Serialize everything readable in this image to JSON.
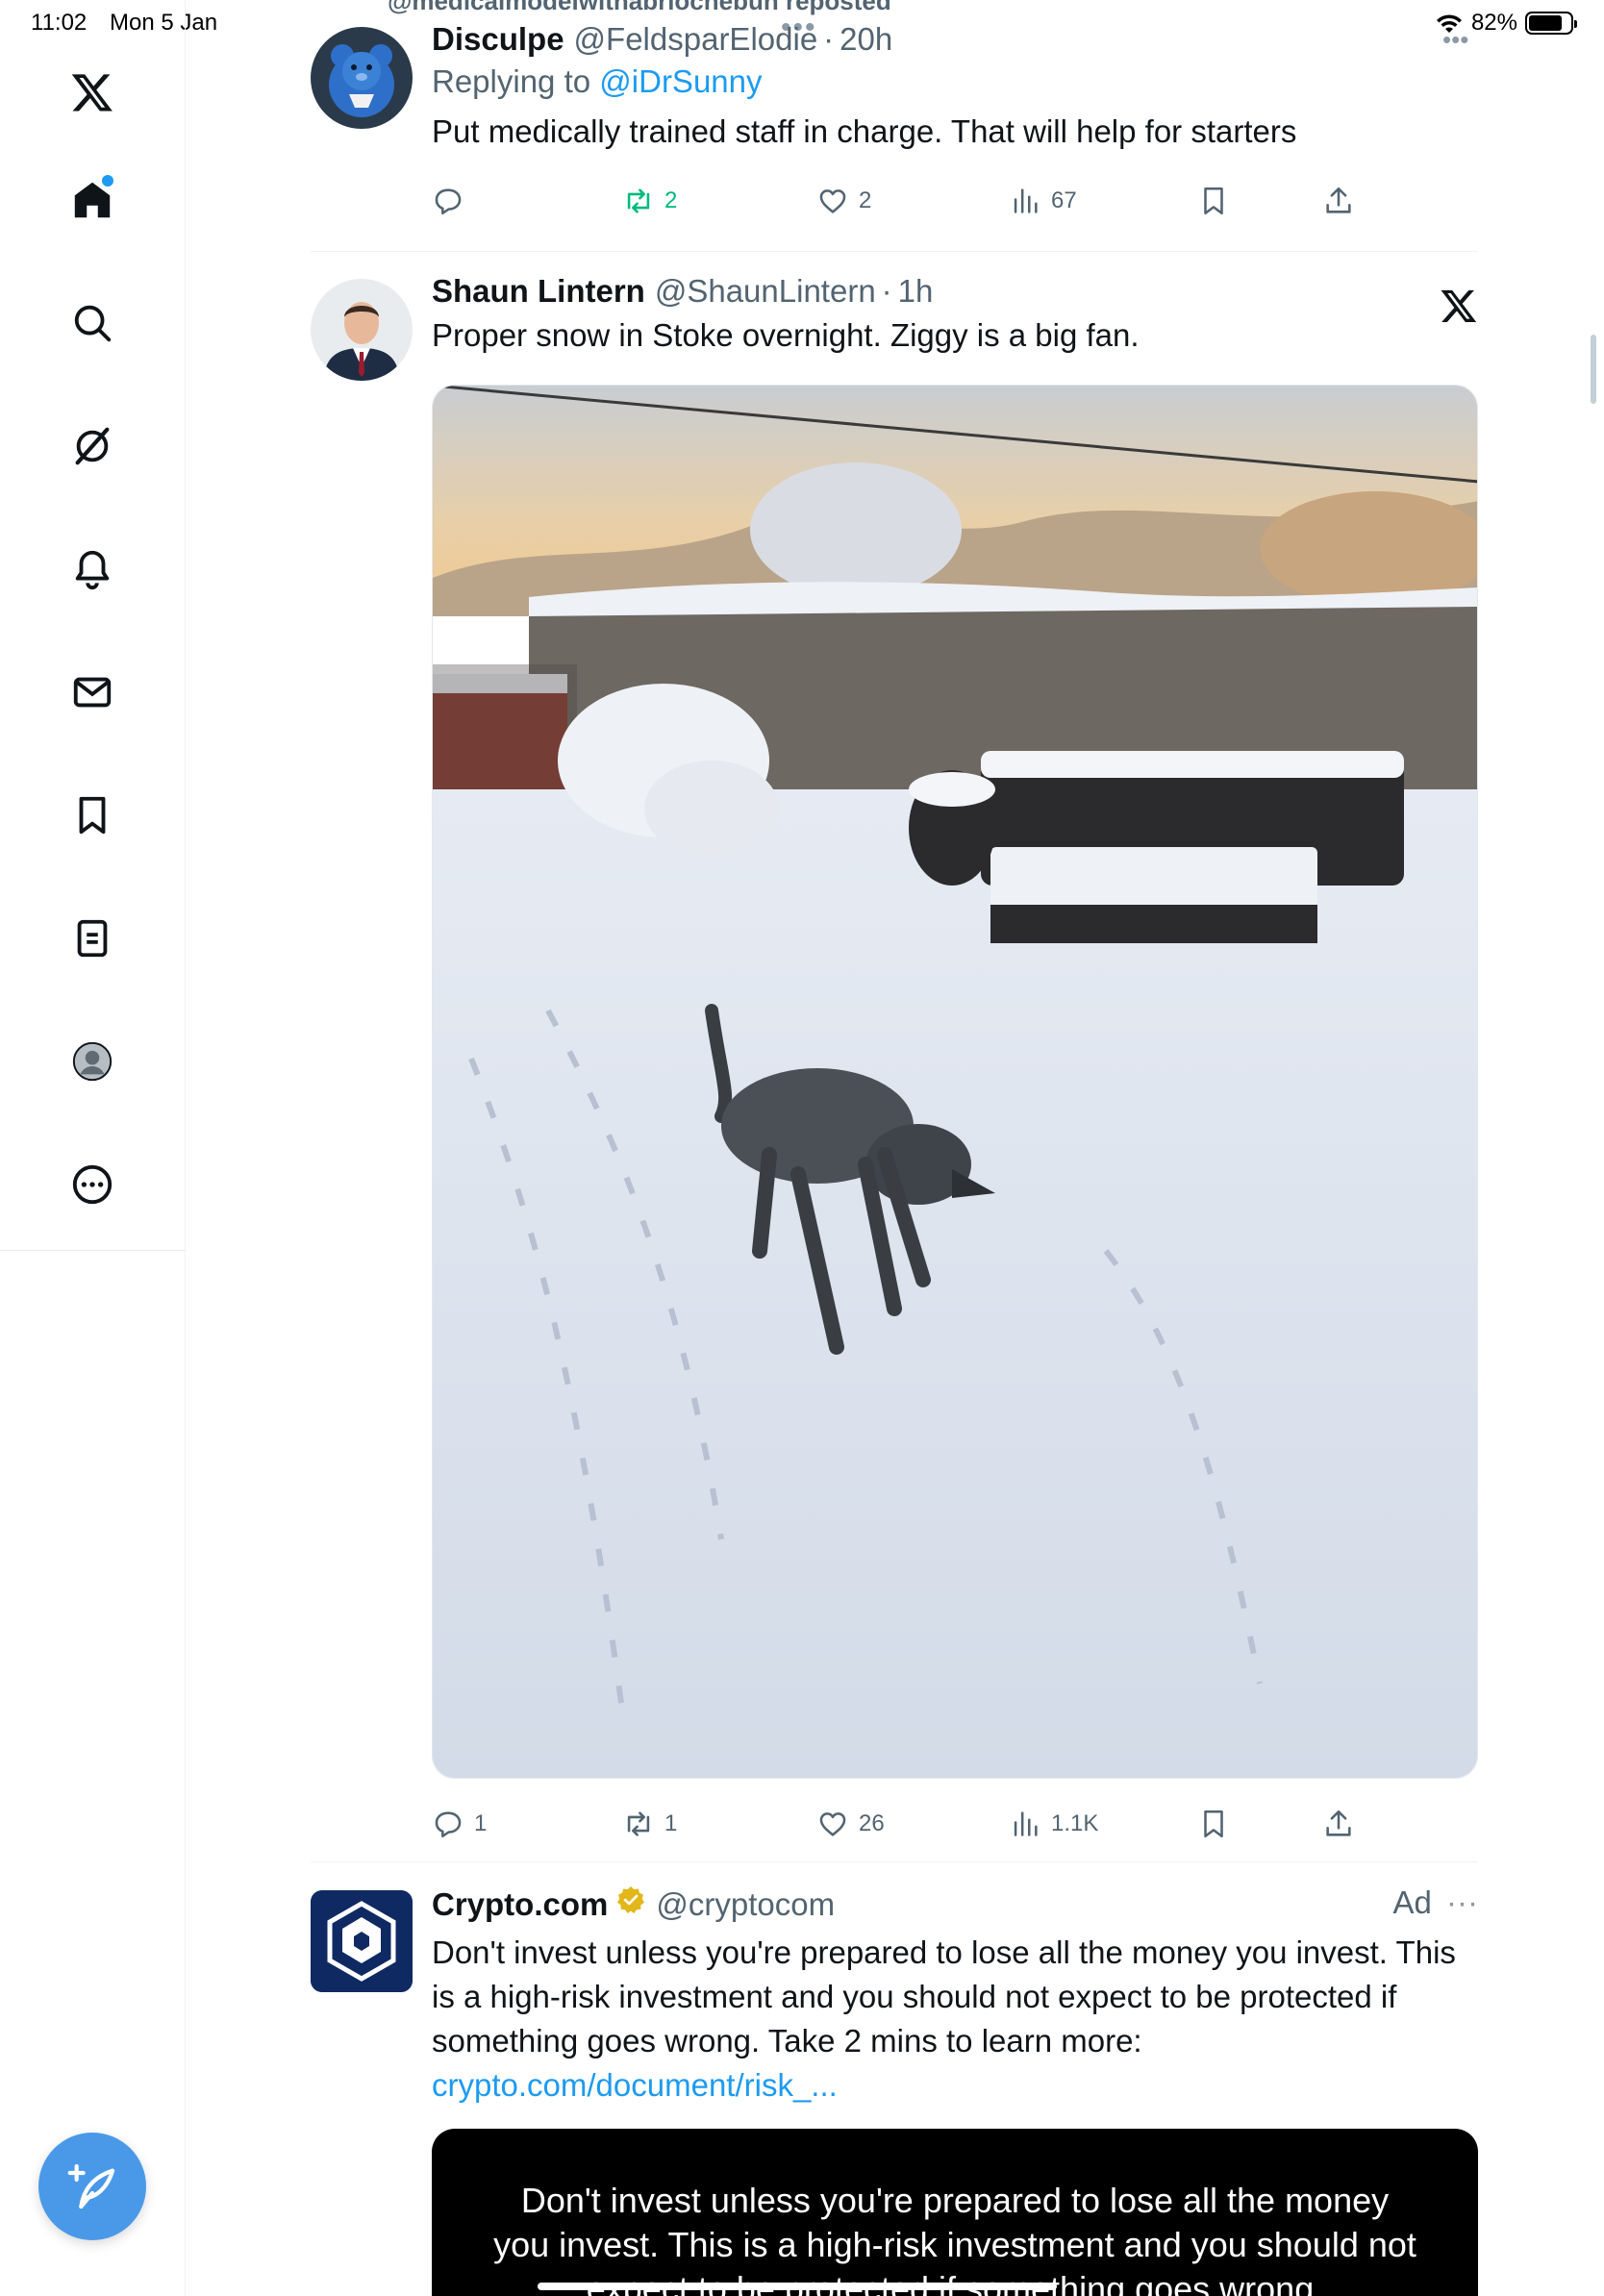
{
  "status_bar": {
    "time": "11:02",
    "date": "Mon 5 Jan",
    "battery": "82%",
    "battery_level": 0.82
  },
  "sidebar": {
    "items": [
      {
        "name": "home",
        "icon": "home-icon",
        "active": true,
        "has_notification_dot": true
      },
      {
        "name": "search",
        "icon": "search-icon"
      },
      {
        "name": "grok",
        "icon": "grok-icon"
      },
      {
        "name": "notifications",
        "icon": "bell-icon"
      },
      {
        "name": "messages",
        "icon": "mail-icon"
      },
      {
        "name": "bookmarks",
        "icon": "bookmark-icon"
      },
      {
        "name": "lists",
        "icon": "list-icon"
      },
      {
        "name": "profile",
        "icon": "avatar-icon"
      },
      {
        "name": "more",
        "icon": "more-circle-icon"
      }
    ],
    "compose_icon": "compose-post-icon"
  },
  "timeline": {
    "repost_line": "@medicalmodelwithabriochebun reposted",
    "tweets": [
      {
        "name": "Disculpe",
        "handle": "@FeldsparElodie",
        "time": "20h",
        "replying_label": "Replying to",
        "replying_handle": "@iDrSunny",
        "text": "Put medically trained staff in charge. That will help for starters",
        "replies": "",
        "reposts": "2",
        "likes": "2",
        "views": "67"
      },
      {
        "name": "Shaun Lintern",
        "handle": "@ShaunLintern",
        "time": "1h",
        "text": "Proper snow in Stoke overnight. Ziggy is a big fan.",
        "replies": "1",
        "reposts": "1",
        "likes": "26",
        "views": "1.1K",
        "media": "photo of a dog in a snowy garden"
      },
      {
        "name": "Crypto.com",
        "handle": "@cryptocom",
        "ad_label": "Ad",
        "text": "Don't invest unless you're prepared to lose all the money you invest. This is a high-risk investment and you should not expect to be protected if something goes wrong. Take 2 mins to learn more:",
        "link": "crypto.com/document/risk_...",
        "media_text": "Don't invest unless you're prepared to lose all the money you invest. This is a high-risk investment and you should not expect to be protected if something goes wrong."
      }
    ]
  },
  "colors": {
    "accent": "#1d9bf0",
    "repost_green": "#00ba7c",
    "muted": "#536471",
    "compose": "#4a99e9"
  }
}
